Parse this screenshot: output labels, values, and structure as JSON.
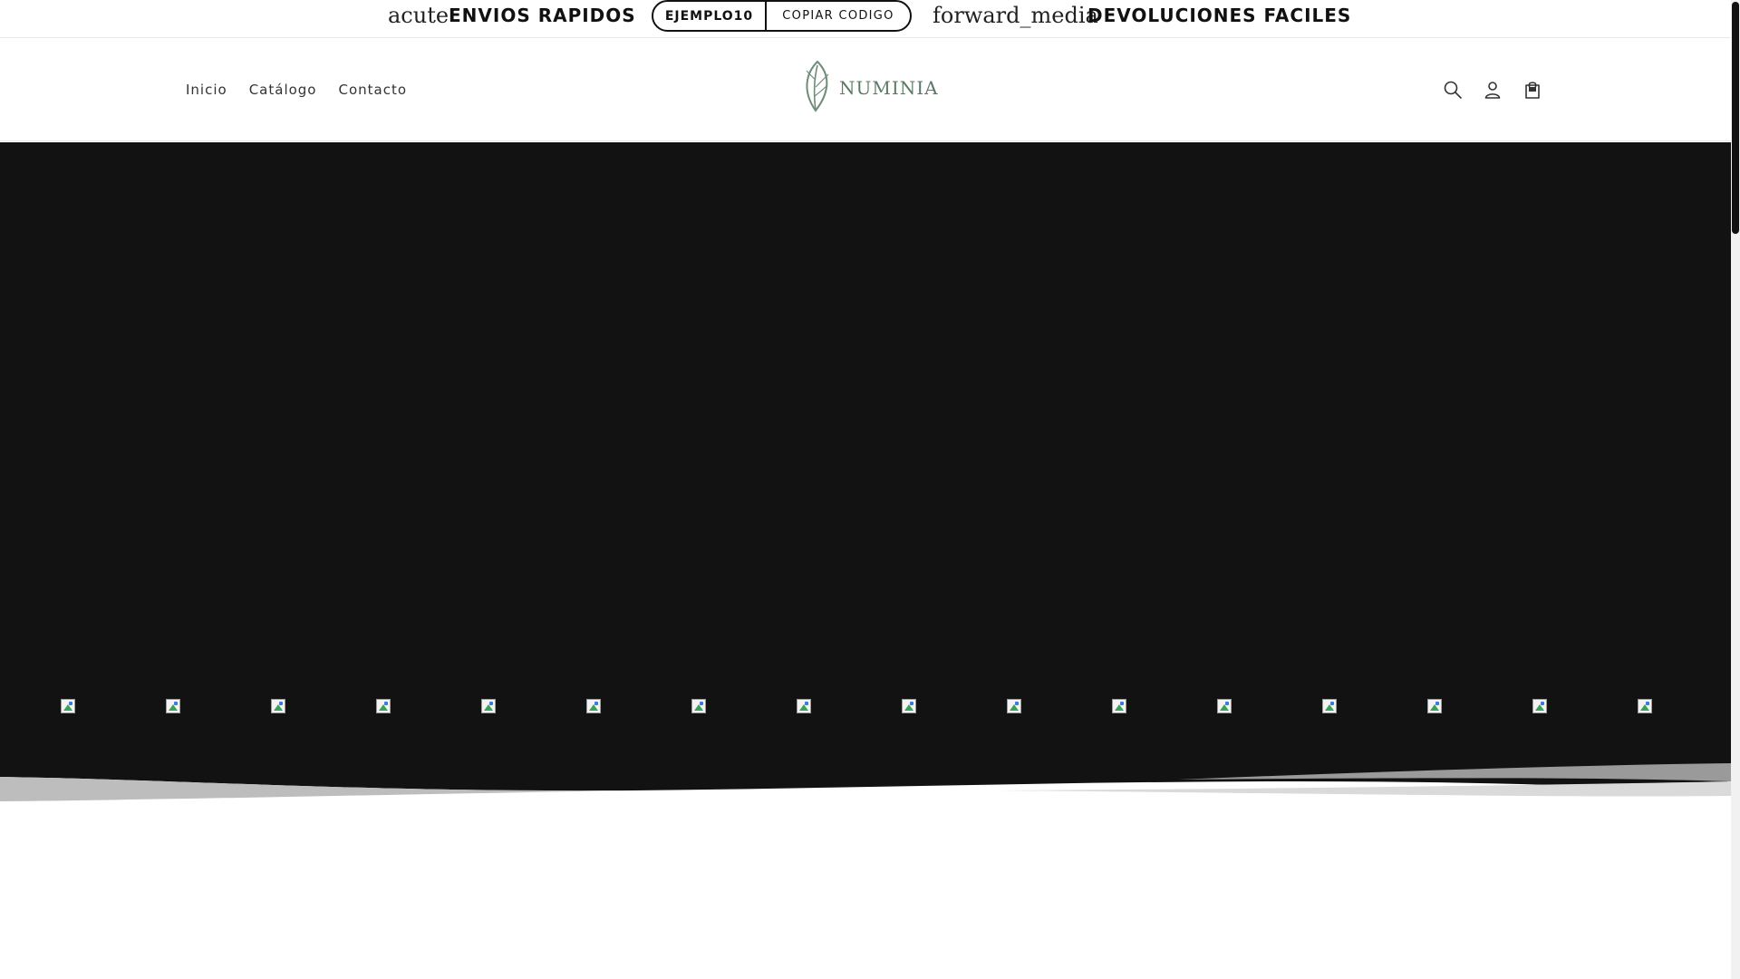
{
  "announcement": {
    "left_icon_label": "acute",
    "left_text": "ENVIOS RAPIDOS",
    "coupon_code": "EJEMPLO10",
    "coupon_copy_label": "COPIAR CODIGO",
    "right_icon_label": "forward_media",
    "right_text": "DEVOLUCIONES FACILES"
  },
  "header": {
    "nav": [
      {
        "label": "Inicio"
      },
      {
        "label": "Catálogo"
      },
      {
        "label": "Contacto"
      }
    ],
    "logo_text": "NUMINIA",
    "icons": [
      "search-icon",
      "account-icon",
      "cart-icon"
    ]
  },
  "hero": {
    "background": "#121212",
    "broken_image_count": 16
  },
  "colors": {
    "brand_green": "#5b7a66",
    "text_dark": "#111111",
    "hero_dark": "#121212"
  }
}
